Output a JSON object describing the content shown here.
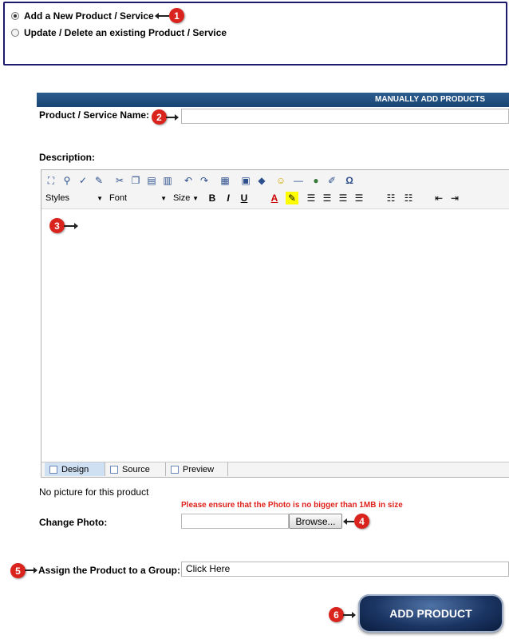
{
  "mode": {
    "options": [
      {
        "label": "Add a New Product / Service",
        "selected": true
      },
      {
        "label": "Update / Delete an existing Product / Service",
        "selected": false
      }
    ]
  },
  "markers": [
    "1",
    "2",
    "3",
    "4",
    "5",
    "6"
  ],
  "form": {
    "header": "MANUALLY ADD PRODUCTS",
    "name_label": "Product / Service Name:",
    "name_value": "",
    "description_label": "Description:",
    "editor": {
      "styles_label": "Styles",
      "font_label": "Font",
      "size_label": "Size",
      "bold": "B",
      "italic": "I",
      "underline": "U",
      "font_color": "A",
      "special_char": "Ω",
      "tabs": [
        "Design",
        "Source",
        "Preview"
      ],
      "active_tab": "Design"
    },
    "no_picture_text": "No picture for this product",
    "photo_warning": "Please ensure that the Photo is no bigger than 1MB in size",
    "change_photo_label": "Change Photo:",
    "browse_label": "Browse...",
    "group_label": "Assign the Product to a Group:",
    "group_value": "Click Here",
    "submit_label": "ADD PRODUCT"
  },
  "colors": {
    "header_bar": "#174474",
    "marker": "#d9231c",
    "warning_text": "#e0221c",
    "mode_border": "#1d1a6e"
  }
}
